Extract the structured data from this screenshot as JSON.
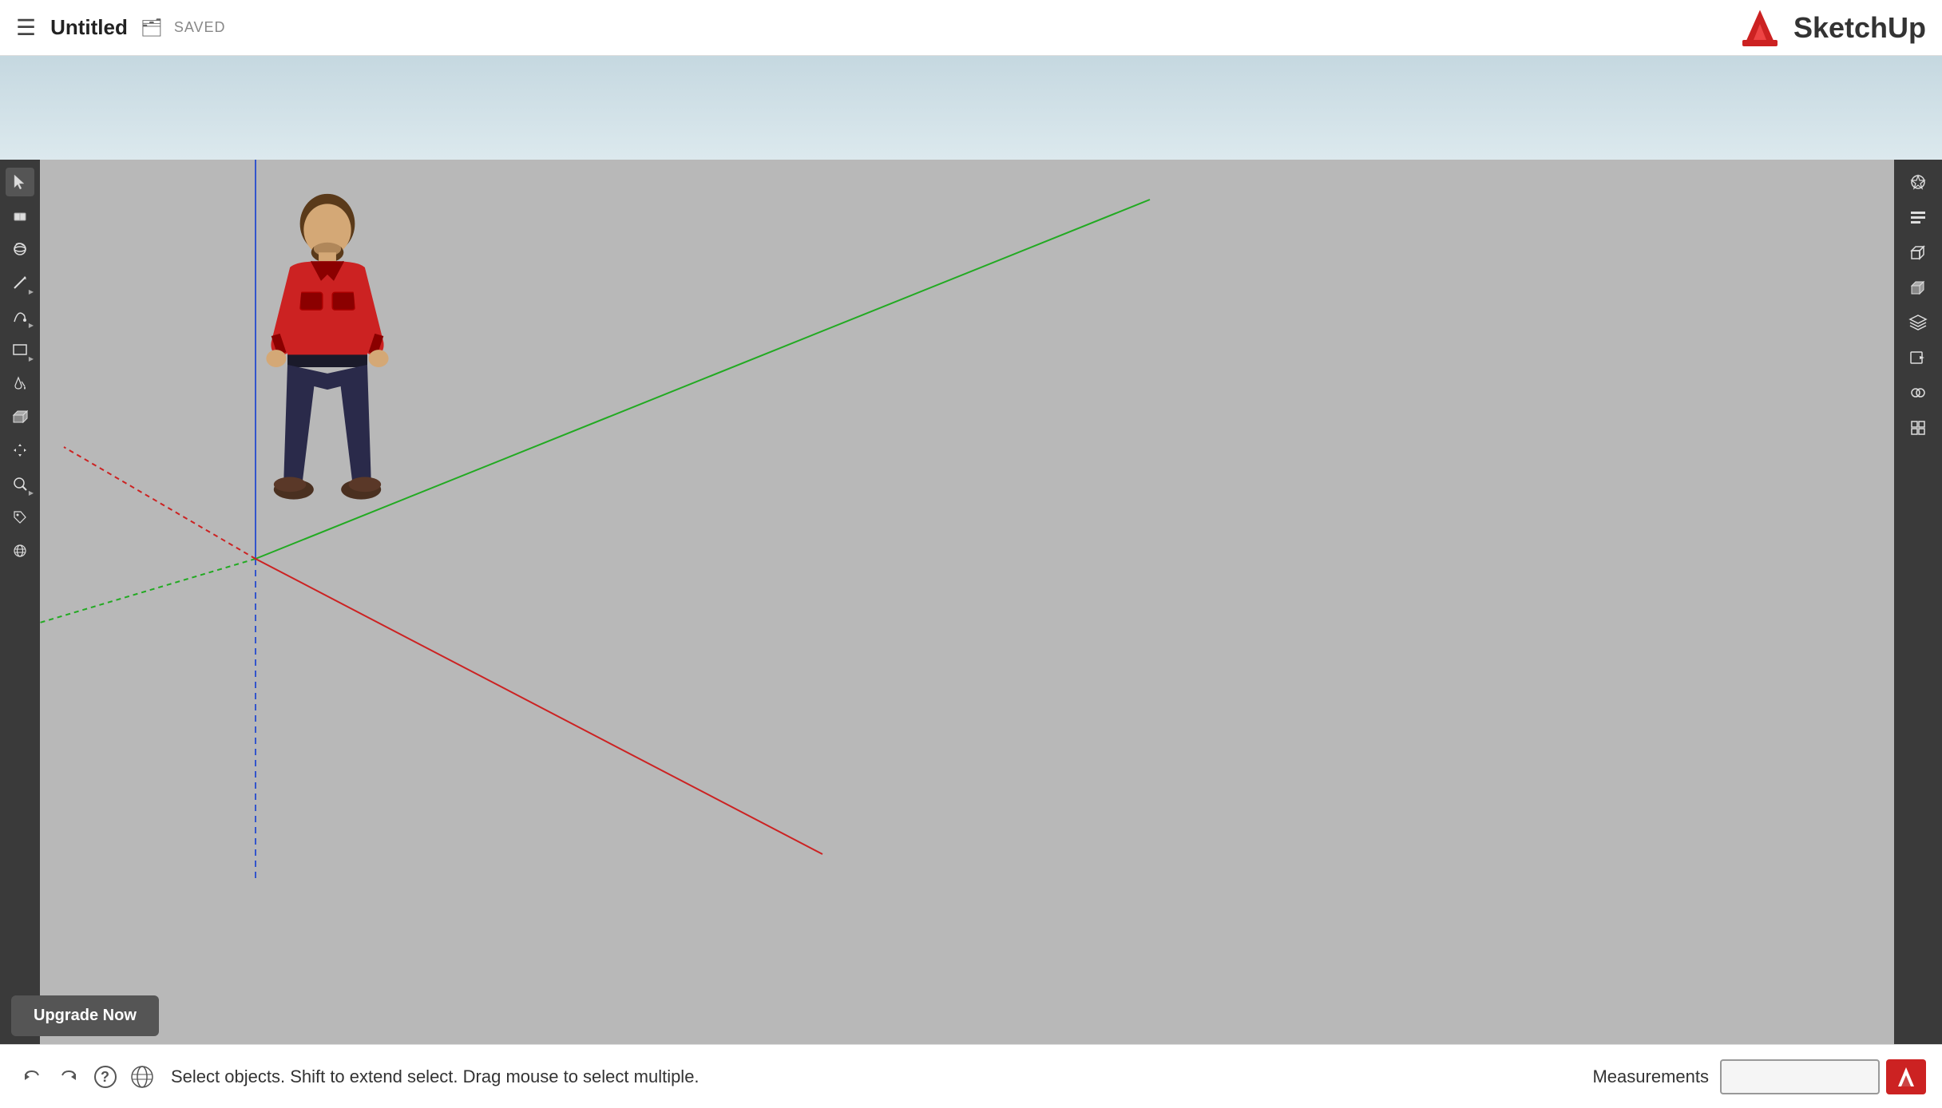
{
  "header": {
    "title": "Untitled",
    "saved_label": "SAVED",
    "hamburger_label": "☰",
    "file_icon": "🗂"
  },
  "logo": {
    "text": "SketchUp",
    "icon_color": "#cc2222"
  },
  "toolbar_left": {
    "tools": [
      {
        "name": "select",
        "label": "↖",
        "has_arrow": false,
        "active": true
      },
      {
        "name": "eraser",
        "label": "⬜",
        "has_arrow": false,
        "active": false
      },
      {
        "name": "orbit",
        "label": "⟳",
        "has_arrow": false,
        "active": false
      },
      {
        "name": "pencil",
        "label": "✏",
        "has_arrow": true,
        "active": false
      },
      {
        "name": "pen",
        "label": "🖊",
        "has_arrow": true,
        "active": false
      },
      {
        "name": "rectangle",
        "label": "▭",
        "has_arrow": true,
        "active": false
      },
      {
        "name": "fill",
        "label": "🪣",
        "has_arrow": false,
        "active": false
      },
      {
        "name": "push-pull",
        "label": "⬛",
        "has_arrow": false,
        "active": false
      },
      {
        "name": "move",
        "label": "✛",
        "has_arrow": false,
        "active": false
      },
      {
        "name": "search",
        "label": "🔍",
        "has_arrow": true,
        "active": false
      },
      {
        "name": "tag",
        "label": "🏷",
        "has_arrow": false,
        "active": false
      },
      {
        "name": "globe",
        "label": "🌐",
        "has_arrow": false,
        "active": false
      }
    ]
  },
  "toolbar_right": {
    "tools": [
      {
        "name": "styles",
        "label": "⬛"
      },
      {
        "name": "layers",
        "label": "☰"
      },
      {
        "name": "components",
        "label": "🎲"
      },
      {
        "name": "solid-tools",
        "label": "◼"
      },
      {
        "name": "stacked",
        "label": "⊟"
      },
      {
        "name": "camera",
        "label": "📷"
      },
      {
        "name": "glasses",
        "label": "👓"
      },
      {
        "name": "grid",
        "label": "⊞"
      }
    ]
  },
  "bottom_bar": {
    "undo_icon": "↩",
    "redo_icon": "↪",
    "help_icon": "?",
    "location_icon": "🌐",
    "status_text": "Select objects. Shift to extend select. Drag mouse to select multiple.",
    "measurements_label": "Measurements",
    "sketchup_icon": "S"
  },
  "upgrade_button": {
    "label": "Upgrade Now"
  },
  "canvas": {
    "sky_gradient_top": "#c5d8e0",
    "sky_gradient_bottom": "#dce9ee",
    "ground_color": "#b8b8b8",
    "axis_colors": {
      "blue": "#3355cc",
      "green": "#22aa22",
      "red": "#cc2222"
    }
  }
}
